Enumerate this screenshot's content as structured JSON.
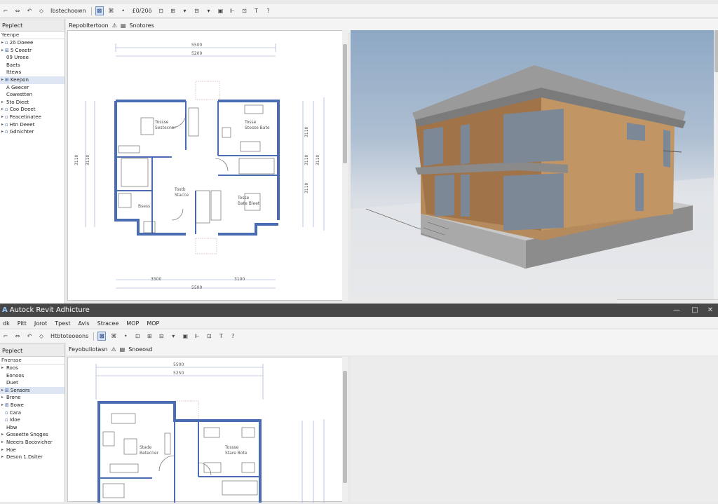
{
  "win1": {
    "toolbar_label": "Ibstechoown",
    "toolbar_num": "£0/20ö",
    "browser_title": "Peplect",
    "browser_sub": "Yeenpe",
    "tree": [
      {
        "tog": "▸",
        "icon": "▫",
        "label": "2ö Doeee"
      },
      {
        "tog": "▸",
        "icon": "⊞",
        "label": "5 Coeetr"
      },
      {
        "tog": "",
        "icon": "",
        "label": "09 Ureee"
      },
      {
        "tog": "",
        "icon": "",
        "label": "Baets"
      },
      {
        "tog": "",
        "icon": "",
        "label": "Ittews"
      },
      {
        "tog": "▸",
        "icon": "⊞",
        "label": "Keepon"
      },
      {
        "tog": "",
        "icon": "",
        "label": "A Geecer"
      },
      {
        "tog": "",
        "icon": "",
        "label": "Cowestten"
      },
      {
        "tog": "▸",
        "icon": "",
        "label": "5to Dieet"
      },
      {
        "tog": "▸",
        "icon": "▫",
        "label": "Coo Deeet"
      },
      {
        "tog": "▸",
        "icon": "▫",
        "label": "Feacetinatee"
      },
      {
        "tog": "▸",
        "icon": "▫",
        "label": "Htn Deeet"
      },
      {
        "tog": "▸",
        "icon": "▫",
        "label": "Gdnichter"
      }
    ],
    "view_title": "Repobltertoon",
    "view_title2": "Snotores",
    "plan": {
      "top_dim1": "5500",
      "top_dim2": "5200",
      "bottom_dim1": "3500",
      "bottom_dim2": "3100",
      "bottom_dim3": "5500",
      "room1": [
        "Tossse",
        "Sestecner"
      ],
      "room2": [
        "Tosse",
        "Stosse Bate"
      ],
      "room3": [
        "Tostb",
        "Stacce"
      ],
      "room4": [
        "Tosse",
        "Bate Bleet"
      ],
      "room5": "Bsess",
      "left_dims": [
        "3110",
        "3110"
      ],
      "right_dims": [
        "3110",
        "3110",
        "3110",
        "3110"
      ]
    }
  },
  "win2": {
    "title": "Autock Revit Adhicture",
    "logo": "A",
    "menu": [
      "dk",
      "Pitt",
      "Jorot",
      "Tpest",
      "Avis",
      "Stracee",
      "MOP",
      "MOP"
    ],
    "toolbar_label": "Htbtoteoeons",
    "browser_title": "Peplect",
    "browser_sub": "Fnensse",
    "tree": [
      {
        "tog": "▸",
        "icon": "",
        "label": "Roos"
      },
      {
        "tog": "",
        "icon": "",
        "label": "Eonoos"
      },
      {
        "tog": "",
        "icon": "",
        "label": "Duet"
      },
      {
        "tog": "▸",
        "icon": "⊞",
        "label": "Sensors"
      },
      {
        "tog": "▸",
        "icon": "",
        "label": "Brone"
      },
      {
        "tog": "▸",
        "icon": "⊞",
        "label": "Bowe"
      },
      {
        "tog": "",
        "icon": "▫",
        "label": "Cara"
      },
      {
        "tog": "",
        "icon": "▫",
        "label": "Idoe"
      },
      {
        "tog": "",
        "icon": "",
        "label": "Hbw"
      },
      {
        "tog": "▸",
        "icon": "",
        "label": "Goseette Snqges"
      },
      {
        "tog": "▸",
        "icon": "",
        "label": "Neeers Bocovicher"
      },
      {
        "tog": "▸",
        "icon": "",
        "label": "Hoe"
      },
      {
        "tog": "▸",
        "icon": "",
        "label": "Deson 1.Dslter"
      }
    ],
    "view_title": "Feyobuliotasn",
    "view_title2": "Snoeosd",
    "plan": {
      "top_dim1": "5500",
      "top_dim2": "5250",
      "room1": [
        "Stade",
        "Betecner"
      ],
      "room2": [
        "Tossse",
        "Stare Bote"
      ]
    }
  },
  "colors": {
    "blueprint": "#4a6cb3",
    "wood": "#b08256",
    "concrete": "#8e8e8e",
    "sky": "#8ea8c4"
  }
}
